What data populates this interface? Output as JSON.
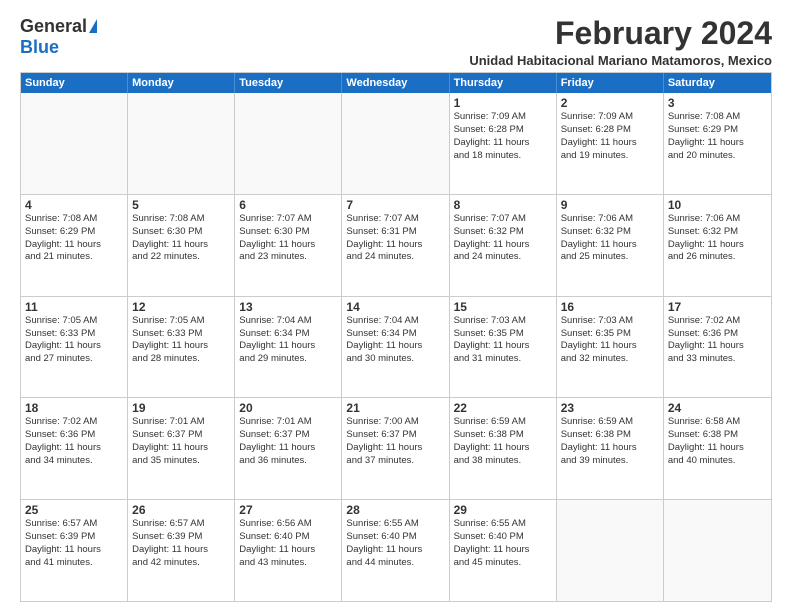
{
  "logo": {
    "general": "General",
    "blue": "Blue"
  },
  "title": "February 2024",
  "subtitle": "Unidad Habitacional Mariano Matamoros, Mexico",
  "days_of_week": [
    "Sunday",
    "Monday",
    "Tuesday",
    "Wednesday",
    "Thursday",
    "Friday",
    "Saturday"
  ],
  "weeks": [
    [
      {
        "day": "",
        "info": ""
      },
      {
        "day": "",
        "info": ""
      },
      {
        "day": "",
        "info": ""
      },
      {
        "day": "",
        "info": ""
      },
      {
        "day": "1",
        "info": "Sunrise: 7:09 AM\nSunset: 6:28 PM\nDaylight: 11 hours\nand 18 minutes."
      },
      {
        "day": "2",
        "info": "Sunrise: 7:09 AM\nSunset: 6:28 PM\nDaylight: 11 hours\nand 19 minutes."
      },
      {
        "day": "3",
        "info": "Sunrise: 7:08 AM\nSunset: 6:29 PM\nDaylight: 11 hours\nand 20 minutes."
      }
    ],
    [
      {
        "day": "4",
        "info": "Sunrise: 7:08 AM\nSunset: 6:29 PM\nDaylight: 11 hours\nand 21 minutes."
      },
      {
        "day": "5",
        "info": "Sunrise: 7:08 AM\nSunset: 6:30 PM\nDaylight: 11 hours\nand 22 minutes."
      },
      {
        "day": "6",
        "info": "Sunrise: 7:07 AM\nSunset: 6:30 PM\nDaylight: 11 hours\nand 23 minutes."
      },
      {
        "day": "7",
        "info": "Sunrise: 7:07 AM\nSunset: 6:31 PM\nDaylight: 11 hours\nand 24 minutes."
      },
      {
        "day": "8",
        "info": "Sunrise: 7:07 AM\nSunset: 6:32 PM\nDaylight: 11 hours\nand 24 minutes."
      },
      {
        "day": "9",
        "info": "Sunrise: 7:06 AM\nSunset: 6:32 PM\nDaylight: 11 hours\nand 25 minutes."
      },
      {
        "day": "10",
        "info": "Sunrise: 7:06 AM\nSunset: 6:32 PM\nDaylight: 11 hours\nand 26 minutes."
      }
    ],
    [
      {
        "day": "11",
        "info": "Sunrise: 7:05 AM\nSunset: 6:33 PM\nDaylight: 11 hours\nand 27 minutes."
      },
      {
        "day": "12",
        "info": "Sunrise: 7:05 AM\nSunset: 6:33 PM\nDaylight: 11 hours\nand 28 minutes."
      },
      {
        "day": "13",
        "info": "Sunrise: 7:04 AM\nSunset: 6:34 PM\nDaylight: 11 hours\nand 29 minutes."
      },
      {
        "day": "14",
        "info": "Sunrise: 7:04 AM\nSunset: 6:34 PM\nDaylight: 11 hours\nand 30 minutes."
      },
      {
        "day": "15",
        "info": "Sunrise: 7:03 AM\nSunset: 6:35 PM\nDaylight: 11 hours\nand 31 minutes."
      },
      {
        "day": "16",
        "info": "Sunrise: 7:03 AM\nSunset: 6:35 PM\nDaylight: 11 hours\nand 32 minutes."
      },
      {
        "day": "17",
        "info": "Sunrise: 7:02 AM\nSunset: 6:36 PM\nDaylight: 11 hours\nand 33 minutes."
      }
    ],
    [
      {
        "day": "18",
        "info": "Sunrise: 7:02 AM\nSunset: 6:36 PM\nDaylight: 11 hours\nand 34 minutes."
      },
      {
        "day": "19",
        "info": "Sunrise: 7:01 AM\nSunset: 6:37 PM\nDaylight: 11 hours\nand 35 minutes."
      },
      {
        "day": "20",
        "info": "Sunrise: 7:01 AM\nSunset: 6:37 PM\nDaylight: 11 hours\nand 36 minutes."
      },
      {
        "day": "21",
        "info": "Sunrise: 7:00 AM\nSunset: 6:37 PM\nDaylight: 11 hours\nand 37 minutes."
      },
      {
        "day": "22",
        "info": "Sunrise: 6:59 AM\nSunset: 6:38 PM\nDaylight: 11 hours\nand 38 minutes."
      },
      {
        "day": "23",
        "info": "Sunrise: 6:59 AM\nSunset: 6:38 PM\nDaylight: 11 hours\nand 39 minutes."
      },
      {
        "day": "24",
        "info": "Sunrise: 6:58 AM\nSunset: 6:38 PM\nDaylight: 11 hours\nand 40 minutes."
      }
    ],
    [
      {
        "day": "25",
        "info": "Sunrise: 6:57 AM\nSunset: 6:39 PM\nDaylight: 11 hours\nand 41 minutes."
      },
      {
        "day": "26",
        "info": "Sunrise: 6:57 AM\nSunset: 6:39 PM\nDaylight: 11 hours\nand 42 minutes."
      },
      {
        "day": "27",
        "info": "Sunrise: 6:56 AM\nSunset: 6:40 PM\nDaylight: 11 hours\nand 43 minutes."
      },
      {
        "day": "28",
        "info": "Sunrise: 6:55 AM\nSunset: 6:40 PM\nDaylight: 11 hours\nand 44 minutes."
      },
      {
        "day": "29",
        "info": "Sunrise: 6:55 AM\nSunset: 6:40 PM\nDaylight: 11 hours\nand 45 minutes."
      },
      {
        "day": "",
        "info": ""
      },
      {
        "day": "",
        "info": ""
      }
    ]
  ]
}
